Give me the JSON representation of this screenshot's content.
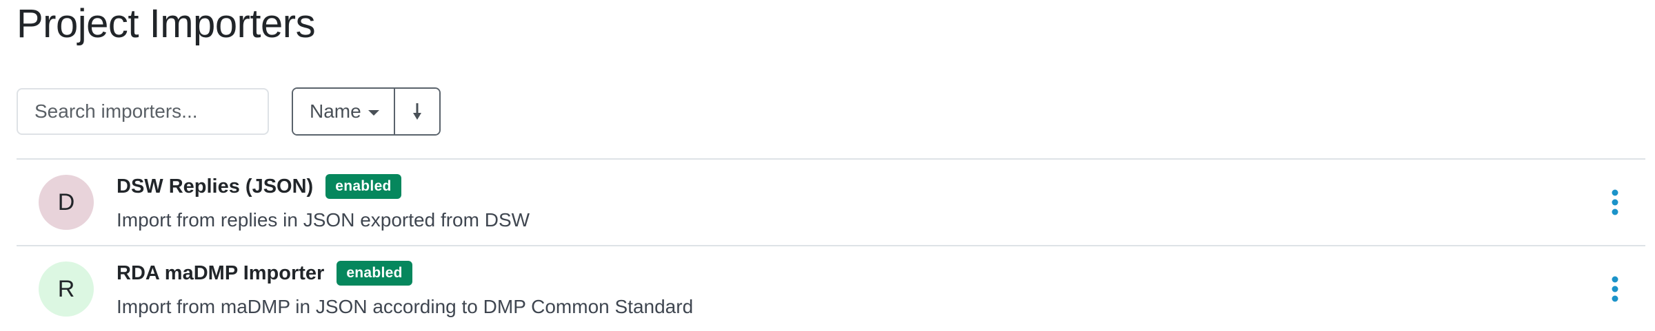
{
  "page": {
    "title": "Project Importers"
  },
  "toolbar": {
    "search_placeholder": "Search importers...",
    "sort_label": "Name",
    "sort_direction_icon": "arrow-down-icon",
    "sort_caret_icon": "caret-down-icon"
  },
  "importers": [
    {
      "initial": "D",
      "name": "DSW Replies (JSON)",
      "status": "enabled",
      "description": "Import from replies in JSON exported from DSW",
      "avatar_color": "#e8d3da",
      "menu_icon": "vertical-dots-icon"
    },
    {
      "initial": "R",
      "name": "RDA maDMP Importer",
      "status": "enabled",
      "description": "Import from maDMP in JSON according to DMP Common Standard",
      "avatar_color": "#dcf7e2",
      "menu_icon": "vertical-dots-icon"
    }
  ],
  "colors": {
    "badge": "#06875d",
    "menu_icon": "#1b93c9",
    "border": "#dee2e6"
  }
}
